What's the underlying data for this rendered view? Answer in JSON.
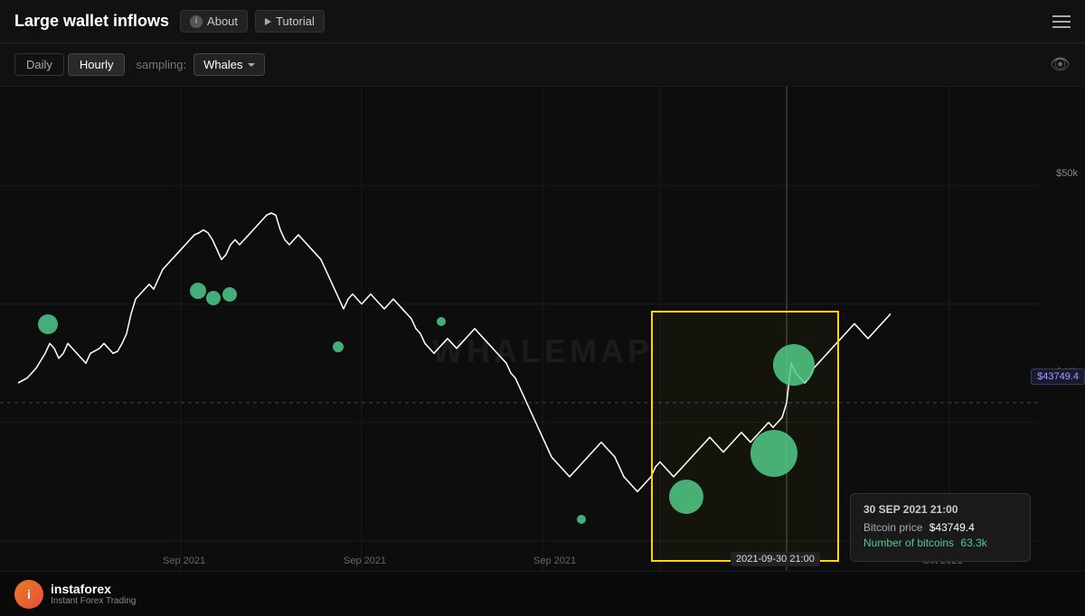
{
  "header": {
    "title": "Large wallet inflows",
    "about_label": "About",
    "tutorial_label": "Tutorial"
  },
  "toolbar": {
    "tab_daily": "Daily",
    "tab_hourly": "Hourly",
    "sampling_label": "sampling:",
    "dropdown_label": "Whales",
    "active_tab": "Hourly"
  },
  "chart": {
    "watermark": "WHALEMAP",
    "y_labels": [
      "$50k",
      "$40k"
    ],
    "price_tag": "$43749.4",
    "x_labels": [
      "Sep 2021",
      "Sep 2021",
      "Sep 2021",
      "Sep 2021",
      "Oct 2021"
    ],
    "active_date": "2021-09-30 21:00",
    "tooltip": {
      "date": "30 SEP 2021 21:00",
      "bitcoin_price_label": "Bitcoin price",
      "bitcoin_price_value": "$43749.4",
      "num_bitcoins_label": "Number of bitcoins",
      "num_bitcoins_value": "63.3k"
    }
  },
  "footer": {
    "logo_letter": "i",
    "brand_name": "instaforex",
    "tagline": "Instant Forex Trading"
  }
}
